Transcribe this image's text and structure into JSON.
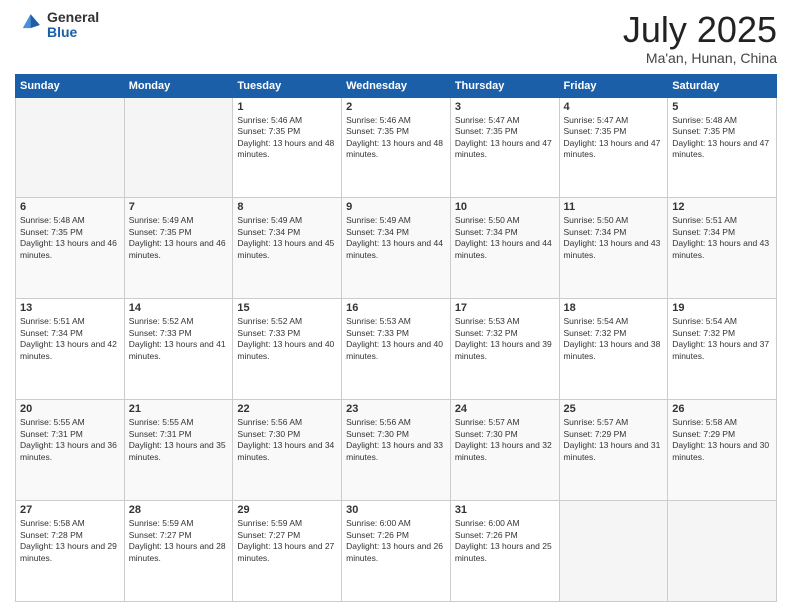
{
  "logo": {
    "general": "General",
    "blue": "Blue"
  },
  "header": {
    "month": "July 2025",
    "location": "Ma'an, Hunan, China"
  },
  "weekdays": [
    "Sunday",
    "Monday",
    "Tuesday",
    "Wednesday",
    "Thursday",
    "Friday",
    "Saturday"
  ],
  "weeks": [
    [
      {
        "day": "",
        "content": ""
      },
      {
        "day": "",
        "content": ""
      },
      {
        "day": "1",
        "content": "Sunrise: 5:46 AM\nSunset: 7:35 PM\nDaylight: 13 hours and 48 minutes."
      },
      {
        "day": "2",
        "content": "Sunrise: 5:46 AM\nSunset: 7:35 PM\nDaylight: 13 hours and 48 minutes."
      },
      {
        "day": "3",
        "content": "Sunrise: 5:47 AM\nSunset: 7:35 PM\nDaylight: 13 hours and 47 minutes."
      },
      {
        "day": "4",
        "content": "Sunrise: 5:47 AM\nSunset: 7:35 PM\nDaylight: 13 hours and 47 minutes."
      },
      {
        "day": "5",
        "content": "Sunrise: 5:48 AM\nSunset: 7:35 PM\nDaylight: 13 hours and 47 minutes."
      }
    ],
    [
      {
        "day": "6",
        "content": "Sunrise: 5:48 AM\nSunset: 7:35 PM\nDaylight: 13 hours and 46 minutes."
      },
      {
        "day": "7",
        "content": "Sunrise: 5:49 AM\nSunset: 7:35 PM\nDaylight: 13 hours and 46 minutes."
      },
      {
        "day": "8",
        "content": "Sunrise: 5:49 AM\nSunset: 7:34 PM\nDaylight: 13 hours and 45 minutes."
      },
      {
        "day": "9",
        "content": "Sunrise: 5:49 AM\nSunset: 7:34 PM\nDaylight: 13 hours and 44 minutes."
      },
      {
        "day": "10",
        "content": "Sunrise: 5:50 AM\nSunset: 7:34 PM\nDaylight: 13 hours and 44 minutes."
      },
      {
        "day": "11",
        "content": "Sunrise: 5:50 AM\nSunset: 7:34 PM\nDaylight: 13 hours and 43 minutes."
      },
      {
        "day": "12",
        "content": "Sunrise: 5:51 AM\nSunset: 7:34 PM\nDaylight: 13 hours and 43 minutes."
      }
    ],
    [
      {
        "day": "13",
        "content": "Sunrise: 5:51 AM\nSunset: 7:34 PM\nDaylight: 13 hours and 42 minutes."
      },
      {
        "day": "14",
        "content": "Sunrise: 5:52 AM\nSunset: 7:33 PM\nDaylight: 13 hours and 41 minutes."
      },
      {
        "day": "15",
        "content": "Sunrise: 5:52 AM\nSunset: 7:33 PM\nDaylight: 13 hours and 40 minutes."
      },
      {
        "day": "16",
        "content": "Sunrise: 5:53 AM\nSunset: 7:33 PM\nDaylight: 13 hours and 40 minutes."
      },
      {
        "day": "17",
        "content": "Sunrise: 5:53 AM\nSunset: 7:32 PM\nDaylight: 13 hours and 39 minutes."
      },
      {
        "day": "18",
        "content": "Sunrise: 5:54 AM\nSunset: 7:32 PM\nDaylight: 13 hours and 38 minutes."
      },
      {
        "day": "19",
        "content": "Sunrise: 5:54 AM\nSunset: 7:32 PM\nDaylight: 13 hours and 37 minutes."
      }
    ],
    [
      {
        "day": "20",
        "content": "Sunrise: 5:55 AM\nSunset: 7:31 PM\nDaylight: 13 hours and 36 minutes."
      },
      {
        "day": "21",
        "content": "Sunrise: 5:55 AM\nSunset: 7:31 PM\nDaylight: 13 hours and 35 minutes."
      },
      {
        "day": "22",
        "content": "Sunrise: 5:56 AM\nSunset: 7:30 PM\nDaylight: 13 hours and 34 minutes."
      },
      {
        "day": "23",
        "content": "Sunrise: 5:56 AM\nSunset: 7:30 PM\nDaylight: 13 hours and 33 minutes."
      },
      {
        "day": "24",
        "content": "Sunrise: 5:57 AM\nSunset: 7:30 PM\nDaylight: 13 hours and 32 minutes."
      },
      {
        "day": "25",
        "content": "Sunrise: 5:57 AM\nSunset: 7:29 PM\nDaylight: 13 hours and 31 minutes."
      },
      {
        "day": "26",
        "content": "Sunrise: 5:58 AM\nSunset: 7:29 PM\nDaylight: 13 hours and 30 minutes."
      }
    ],
    [
      {
        "day": "27",
        "content": "Sunrise: 5:58 AM\nSunset: 7:28 PM\nDaylight: 13 hours and 29 minutes."
      },
      {
        "day": "28",
        "content": "Sunrise: 5:59 AM\nSunset: 7:27 PM\nDaylight: 13 hours and 28 minutes."
      },
      {
        "day": "29",
        "content": "Sunrise: 5:59 AM\nSunset: 7:27 PM\nDaylight: 13 hours and 27 minutes."
      },
      {
        "day": "30",
        "content": "Sunrise: 6:00 AM\nSunset: 7:26 PM\nDaylight: 13 hours and 26 minutes."
      },
      {
        "day": "31",
        "content": "Sunrise: 6:00 AM\nSunset: 7:26 PM\nDaylight: 13 hours and 25 minutes."
      },
      {
        "day": "",
        "content": ""
      },
      {
        "day": "",
        "content": ""
      }
    ]
  ]
}
